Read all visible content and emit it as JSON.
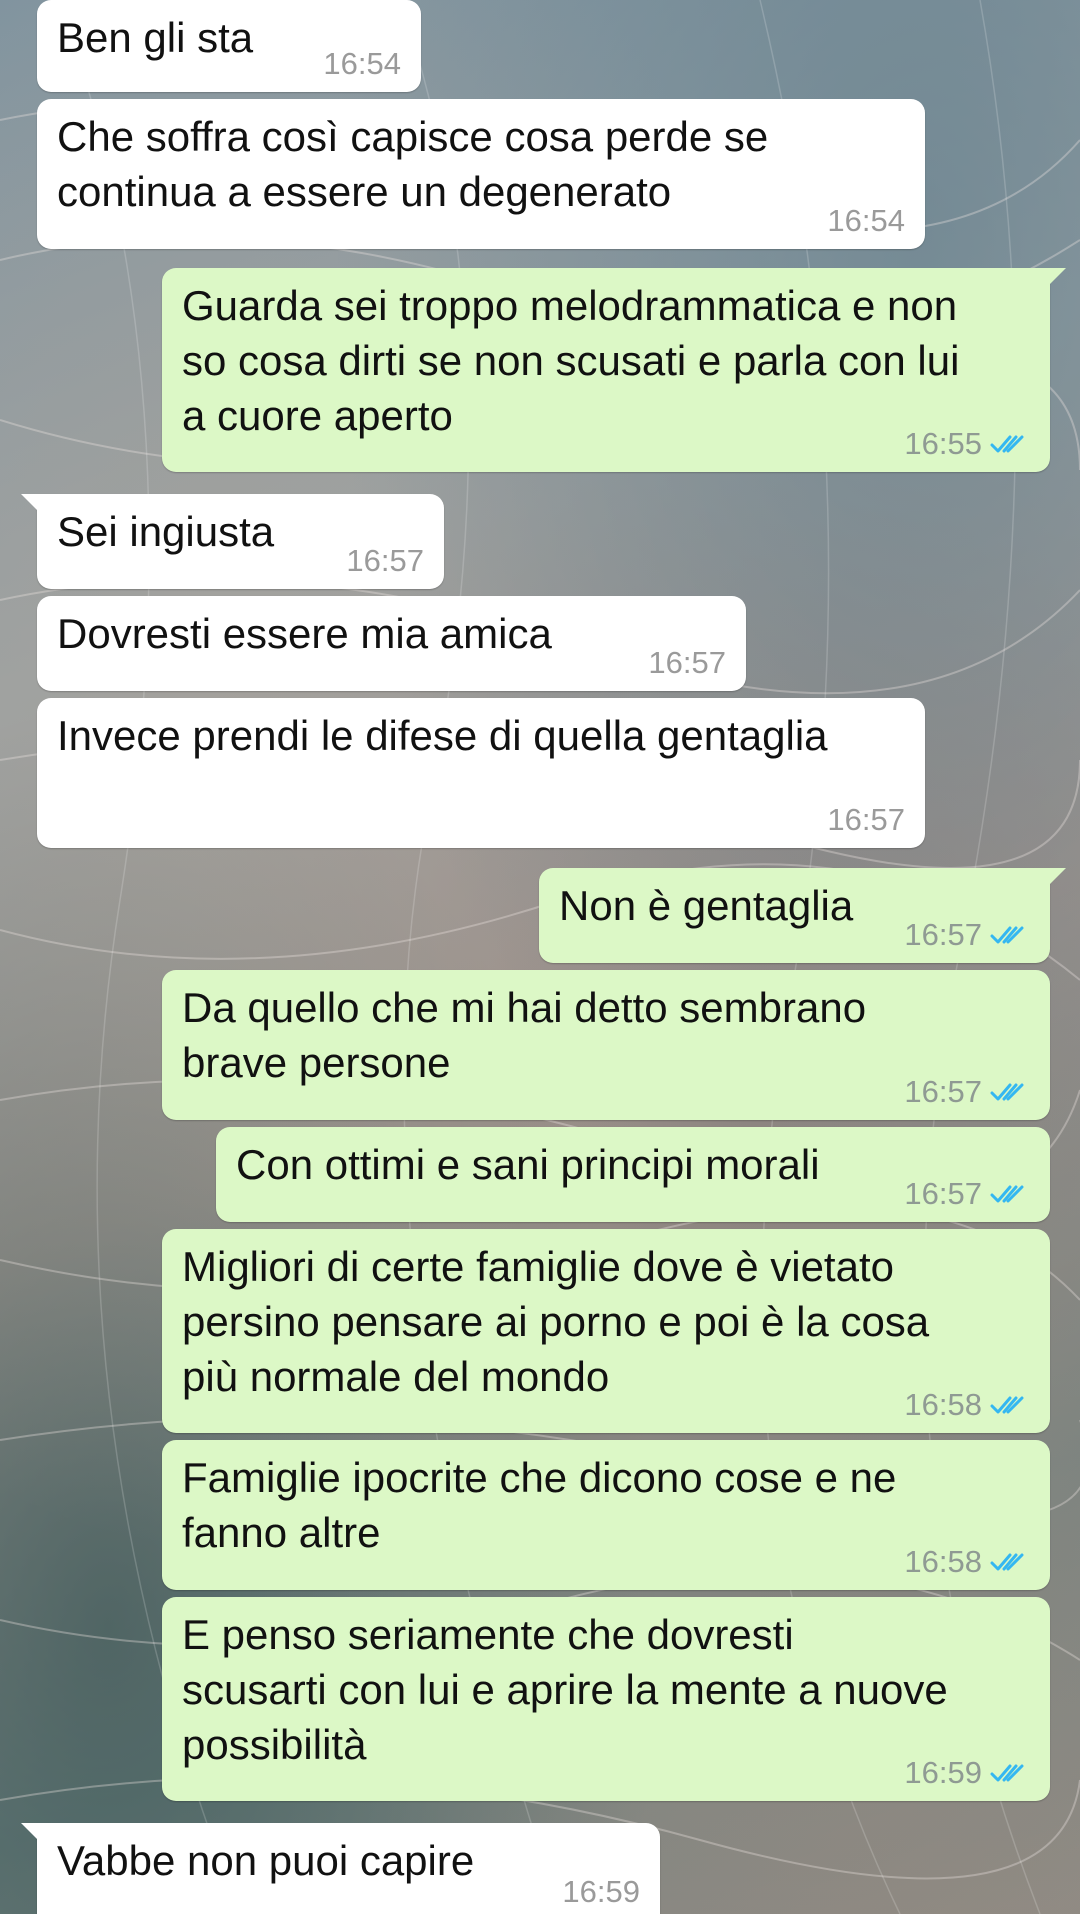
{
  "chat": {
    "messages": [
      {
        "direction": "in",
        "text": "Ben gli sta",
        "time": "16:54"
      },
      {
        "direction": "in",
        "text": "Che soffra così capisce cosa perde se\ncontinua a essere un degenerato",
        "time": "16:54"
      },
      {
        "direction": "out",
        "text": "Guarda sei troppo melodrammatica e non\nso cosa dirti se non scusati e parla con lui\na cuore aperto",
        "time": "16:55",
        "status": "read"
      },
      {
        "direction": "in",
        "text": "Sei ingiusta",
        "time": "16:57"
      },
      {
        "direction": "in",
        "text": "Dovresti essere mia amica",
        "time": "16:57"
      },
      {
        "direction": "in",
        "text": "Invece prendi le difese di quella gentaglia",
        "time": "16:57"
      },
      {
        "direction": "out",
        "text": "Non è gentaglia",
        "time": "16:57",
        "status": "read"
      },
      {
        "direction": "out",
        "text": "Da quello che mi hai detto sembrano\nbrave persone",
        "time": "16:57",
        "status": "read"
      },
      {
        "direction": "out",
        "text": "Con ottimi e sani principi morali",
        "time": "16:57",
        "status": "read"
      },
      {
        "direction": "out",
        "text": "Migliori di certe famiglie dove è vietato\npersino pensare ai porno e poi è la cosa\npiù normale del mondo",
        "time": "16:58",
        "status": "read"
      },
      {
        "direction": "out",
        "text": "Famiglie ipocrite che dicono cose e ne\nfanno altre",
        "time": "16:58",
        "status": "read"
      },
      {
        "direction": "out",
        "text": "E penso seriamente che dovresti\nscusarti con lui e aprire la mente a nuove\npossibilità",
        "time": "16:59",
        "status": "read"
      },
      {
        "direction": "in",
        "text": "Vabbe non puoi capire",
        "time": "16:59"
      }
    ]
  },
  "icons": {
    "read_receipt": "double-check-icon"
  },
  "colors": {
    "incoming_bubble": "#ffffff",
    "outgoing_bubble": "#dcf8c6",
    "read_tick": "#34b7f1",
    "timestamp": "#8f9a93"
  }
}
